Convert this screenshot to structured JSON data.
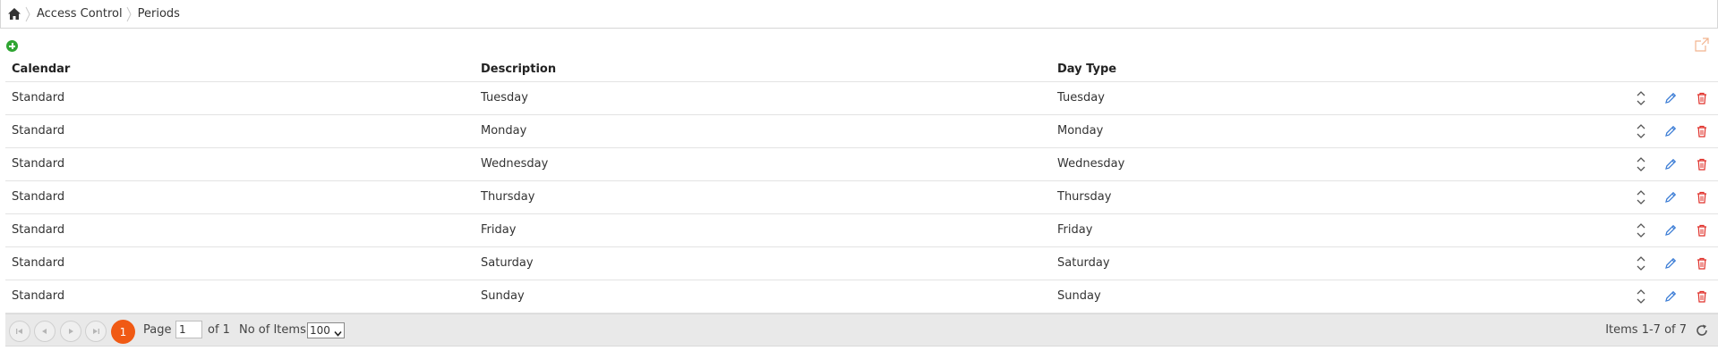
{
  "breadcrumb": {
    "home_icon": "home-icon",
    "items": [
      "Access Control",
      "Periods"
    ]
  },
  "toolbar": {
    "add_icon": "plus-circle-icon",
    "export_icon": "export-icon"
  },
  "grid": {
    "columns": [
      "Calendar",
      "Description",
      "Day Type"
    ],
    "rows": [
      {
        "calendar": "Standard",
        "description": "Tuesday",
        "day_type": "Tuesday"
      },
      {
        "calendar": "Standard",
        "description": "Monday",
        "day_type": "Monday"
      },
      {
        "calendar": "Standard",
        "description": "Wednesday",
        "day_type": "Wednesday"
      },
      {
        "calendar": "Standard",
        "description": "Thursday",
        "day_type": "Thursday"
      },
      {
        "calendar": "Standard",
        "description": "Friday",
        "day_type": "Friday"
      },
      {
        "calendar": "Standard",
        "description": "Saturday",
        "day_type": "Saturday"
      },
      {
        "calendar": "Standard",
        "description": "Sunday",
        "day_type": "Sunday"
      }
    ],
    "row_action_icons": [
      "reorder-icon",
      "edit-icon",
      "delete-icon"
    ]
  },
  "pager": {
    "current_page": "1",
    "page_label": "Page",
    "page_value": "1",
    "of_label": "of 1",
    "items_label": "No of Items",
    "items_per_page": "100",
    "range_text": "Items 1-7 of 7"
  },
  "colors": {
    "accent": "#f05a14",
    "add": "#2fa532",
    "edit": "#3f7fd6",
    "delete": "#e0302a"
  }
}
